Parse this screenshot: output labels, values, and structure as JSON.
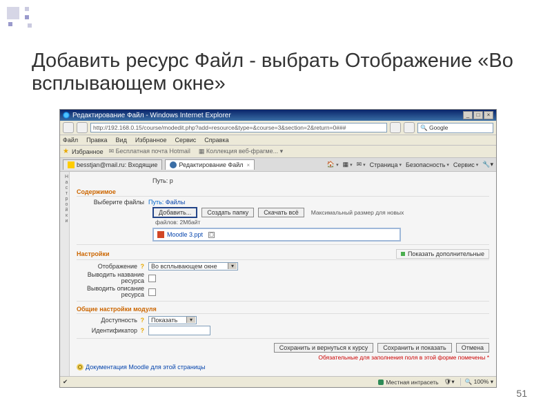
{
  "slide": {
    "title": "Добавить ресурс Файл - выбрать Отображение «Во всплывающем окне»",
    "page_number": "51"
  },
  "window": {
    "title": "Редактирование Файл - Windows Internet Explorer",
    "url": "http://192.168.0.15/course/modedit.php?add=resource&type=&course=3&section=2&return=0###",
    "search_placeholder": "Google",
    "menus": {
      "file": "Файл",
      "edit": "Правка",
      "view": "Вид",
      "favorites": "Избранное",
      "tools": "Сервис",
      "help": "Справка"
    },
    "favbar": {
      "label": "Избранное",
      "item1": "Бесплатная почта Hotmail",
      "item2": "Коллекция веб-фрагме..."
    },
    "tabs": [
      {
        "label": "besstjan@mail.ru: Входящие"
      },
      {
        "label": "Редактирование Файл",
        "active": true
      }
    ],
    "toolbar": {
      "home": "🏠",
      "page": "Страница",
      "safety": "Безопасность",
      "service": "Сервис"
    },
    "status": {
      "zone": "Местная интрасеть",
      "zoom": "100%"
    }
  },
  "form": {
    "sidebar": "Настройки",
    "name_label": "Путь:",
    "name_value": "p",
    "content": {
      "legend": "Содержимое",
      "choose_label": "Выберите файлы",
      "path_prefix": "Путь:",
      "path_link": "Файлы",
      "btn_add": "Добавить...",
      "btn_mkdir": "Создать папку",
      "btn_dlall": "Скачать всё",
      "max_note": "Максимальный размер для новых",
      "max_note2": "файлов: 2Мбайт",
      "file": "Moodle 3.ppt"
    },
    "settings": {
      "legend": "Настройки",
      "show_more": "Показать дополнительные",
      "display_label": "Отображение",
      "display_value": "Во всплывающем окне",
      "show_name_label": "Выводить название ресурса",
      "show_desc_label": "Выводить описание ресурса"
    },
    "common": {
      "legend": "Общие настройки модуля",
      "visible_label": "Доступность",
      "visible_value": "Показать",
      "idnum_label": "Идентификатор"
    },
    "actions": {
      "save_return": "Сохранить и вернуться к курсу",
      "save_show": "Сохранить и показать",
      "cancel": "Отмена"
    },
    "mand_note": "Обязательные для заполнения поля в этой форме помечены *",
    "doc_link": "Документация Moodle для этой страницы"
  }
}
